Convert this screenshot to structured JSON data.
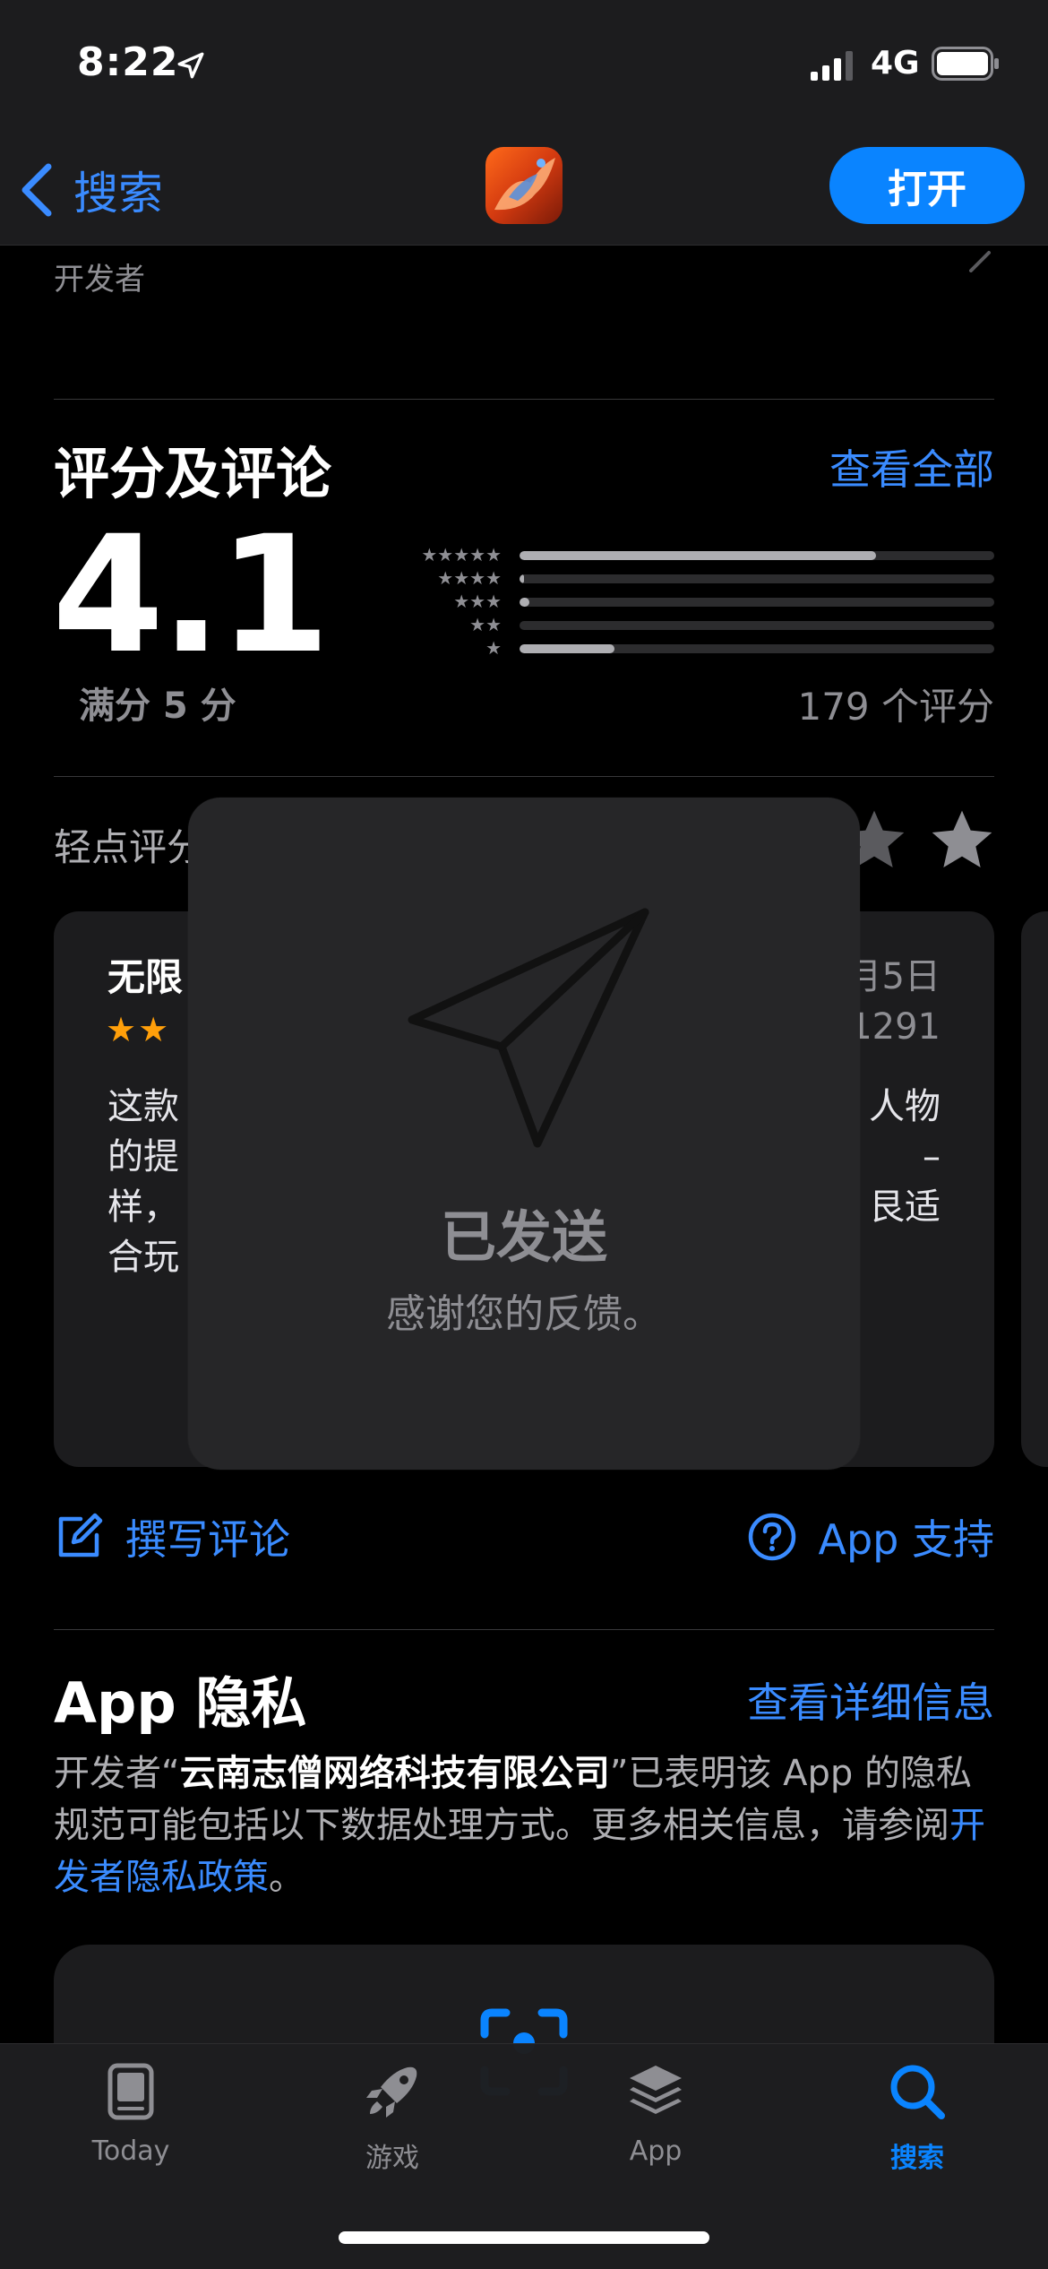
{
  "status_bar": {
    "time": "8:22",
    "network": "4G"
  },
  "nav": {
    "back_label": "搜索",
    "open_label": "打开"
  },
  "developer": {
    "label": "开发者"
  },
  "ratings": {
    "section_title": "评分及评论",
    "see_all": "查看全部",
    "score": "4.1",
    "out_of": "满分 5 分",
    "count": "179 个评分",
    "distribution": [
      {
        "stars": "★★★★★",
        "fraction": 0.75
      },
      {
        "stars": "★★★★",
        "fraction": 0.01
      },
      {
        "stars": "★★★",
        "fraction": 0.02
      },
      {
        "stars": "★★",
        "fraction": 0.0
      },
      {
        "stars": "★",
        "fraction": 0.2
      }
    ],
    "tap_to_rate": "轻点评分："
  },
  "review": {
    "title": "无限",
    "stars": "★★",
    "date": "月5日",
    "author": "1291",
    "body_lines": [
      "这款",
      "的提",
      "样，",
      "合玩"
    ],
    "body_right_lines": [
      "人物",
      "–",
      "艮适",
      ""
    ]
  },
  "hud": {
    "title": "已发送",
    "subtitle": "感谢您的反馈。"
  },
  "actions": {
    "write_review": "撰写评论",
    "app_support": "App 支持"
  },
  "privacy": {
    "title": "App 隐私",
    "details_link": "查看详细信息",
    "text_before": "开发者“",
    "developer_name": "云南志僧网络科技有限公司",
    "text_after": "”已表明该 App 的隐私规范可能包括以下数据处理方式。更多相关信息，请参阅",
    "policy_link": "开发者隐私政策",
    "text_end": "。"
  },
  "tabbar": {
    "tabs": [
      {
        "label": "Today",
        "icon": "today-icon"
      },
      {
        "label": "游戏",
        "icon": "rocket-icon"
      },
      {
        "label": "App",
        "icon": "layers-icon"
      },
      {
        "label": "搜索",
        "icon": "search-icon"
      }
    ],
    "active": "搜索"
  },
  "colors": {
    "accent": "#0a84ff",
    "link": "#3a8bff",
    "star": "#ff9f0a",
    "background": "#000000",
    "card": "#1c1c1e"
  }
}
